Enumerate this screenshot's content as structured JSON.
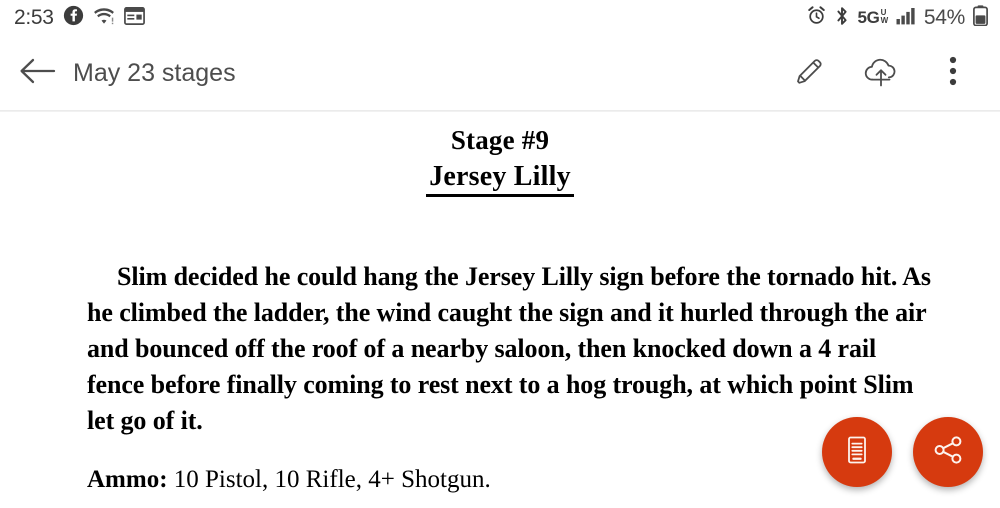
{
  "status_bar": {
    "time": "2:53",
    "left_icons": [
      "facebook-icon",
      "wifi-icon",
      "screenshot-icon"
    ],
    "alarm_icon": "alarm-icon",
    "bluetooth_icon": "bluetooth-icon",
    "network_type": "5G",
    "network_band_top": "U",
    "network_band_bottom": "W",
    "signal_icon": "signal-bars-icon",
    "battery_percent": "54%",
    "battery_icon": "battery-icon"
  },
  "app_bar": {
    "back_icon": "back-arrow-icon",
    "title": "May 23 stages",
    "edit_icon": "pencil-icon",
    "upload_icon": "cloud-upload-icon",
    "overflow_icon": "more-vertical-icon"
  },
  "document": {
    "title": "Stage #9",
    "subtitle": "Jersey Lilly",
    "paragraph": "Slim decided he could hang the Jersey Lilly sign before the tornado hit. As he climbed the ladder, the wind caught the sign and it hurled through the air and bounced off the roof of a nearby saloon, then knocked down a 4 rail fence before finally coming to rest next to a hog trough, at which point Slim let go of it.",
    "ammo_label": "Ammo:",
    "ammo_value": " 10 Pistol, 10 Rifle, 4+ Shotgun."
  },
  "fabs": {
    "accent_color": "#d63a0f",
    "reader_icon": "document-reader-icon",
    "share_icon": "share-icon"
  }
}
